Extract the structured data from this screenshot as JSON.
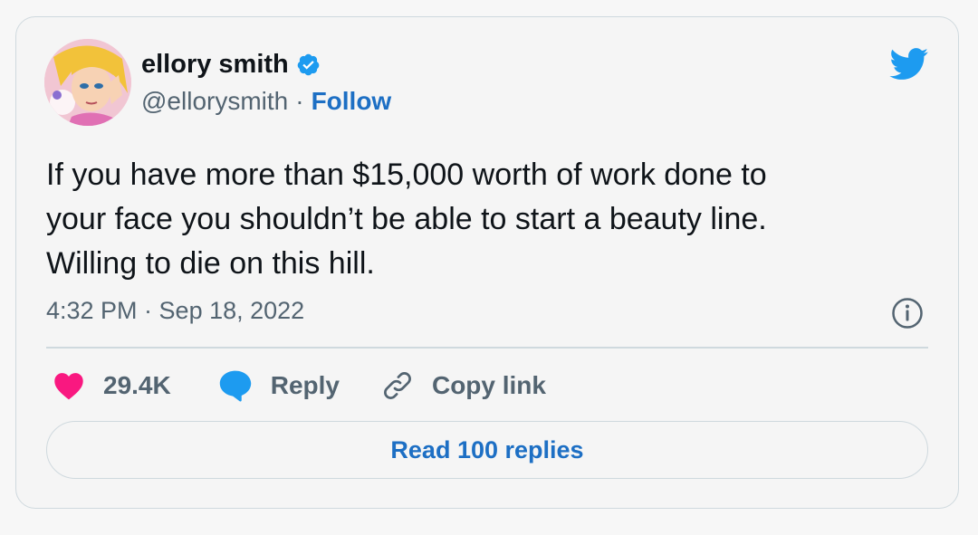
{
  "author": {
    "name": "ellory smith",
    "handle": "@ellorysmith",
    "separator": "·",
    "follow_label": "Follow",
    "verified_icon": "verified-badge-icon"
  },
  "tweet": {
    "text": "If you have more than $15,000 worth of work done to\nyour face you shouldn’t be able to start a beauty line.\nWilling to die on this hill.",
    "timestamp": "4:32 PM · Sep 18, 2022"
  },
  "actions": {
    "like_count": "29.4K",
    "reply_label": "Reply",
    "copy_link_label": "Copy link"
  },
  "read_replies_label": "Read 100 replies",
  "colors": {
    "accent": "#1d6fc4",
    "twitter_blue": "#1d9bf0",
    "heart": "#f91880",
    "text": "#0f1419",
    "muted": "#536471",
    "border": "#cfd9de"
  }
}
